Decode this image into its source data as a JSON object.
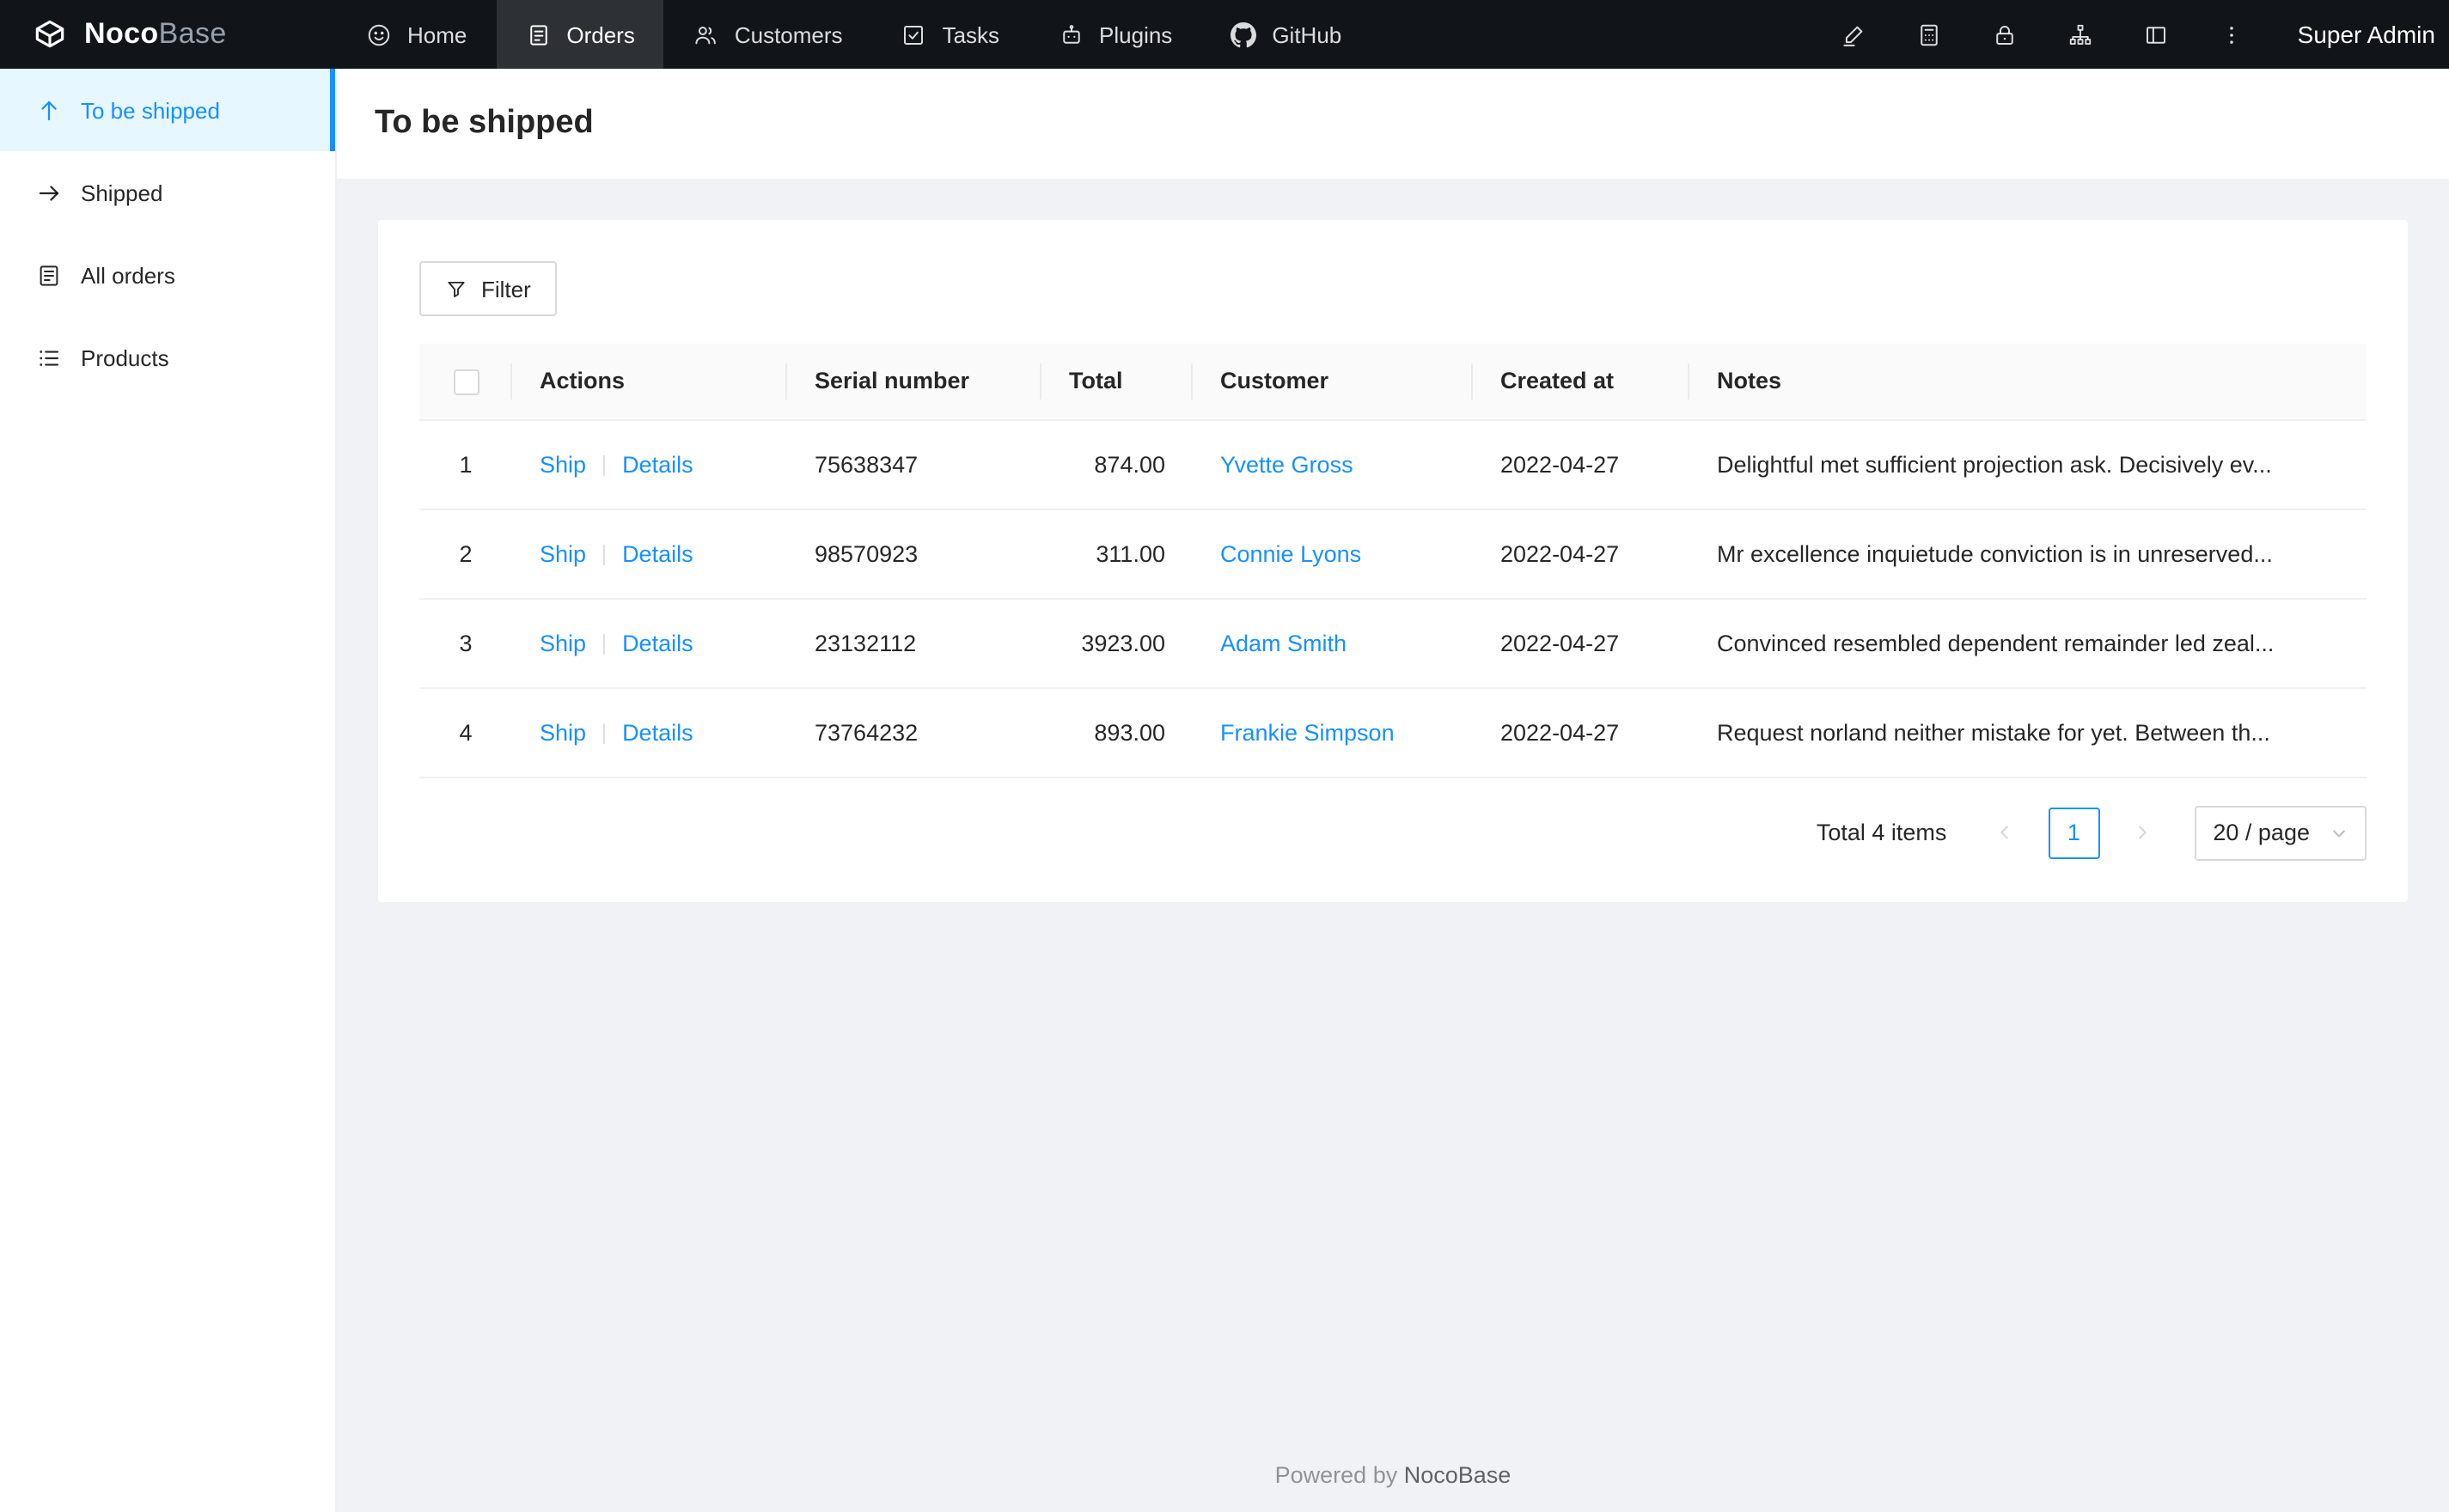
{
  "colors": {
    "accent": "#1890ff",
    "header_bg": "#11151a",
    "sidebar_active_bg": "#e6f7ff",
    "content_bg": "#f0f2f5"
  },
  "header": {
    "brand": {
      "part1": "Noco",
      "part2": "Base"
    },
    "nav": [
      {
        "label": "Home"
      },
      {
        "label": "Orders"
      },
      {
        "label": "Customers"
      },
      {
        "label": "Tasks"
      },
      {
        "label": "Plugins"
      },
      {
        "label": "GitHub"
      }
    ],
    "user": "Super Admin"
  },
  "sidebar": {
    "items": [
      {
        "label": "To be shipped"
      },
      {
        "label": "Shipped"
      },
      {
        "label": "All orders"
      },
      {
        "label": "Products"
      }
    ]
  },
  "page": {
    "title": "To be shipped"
  },
  "toolbar": {
    "filter_label": "Filter"
  },
  "table": {
    "columns": {
      "actions": "Actions",
      "serial": "Serial number",
      "total": "Total",
      "customer": "Customer",
      "created": "Created at",
      "notes": "Notes"
    },
    "rows": [
      {
        "index": "1",
        "ship": "Ship",
        "details": "Details",
        "serial": "75638347",
        "total": "874.00",
        "customer": "Yvette Gross",
        "created": "2022-04-27",
        "notes": "Delightful met sufficient projection ask. Decisively ev..."
      },
      {
        "index": "2",
        "ship": "Ship",
        "details": "Details",
        "serial": "98570923",
        "total": "311.00",
        "customer": "Connie Lyons",
        "created": "2022-04-27",
        "notes": "Mr excellence inquietude conviction is in unreserved..."
      },
      {
        "index": "3",
        "ship": "Ship",
        "details": "Details",
        "serial": "23132112",
        "total": "3923.00",
        "customer": "Adam Smith",
        "created": "2022-04-27",
        "notes": "Convinced resembled dependent remainder led zeal..."
      },
      {
        "index": "4",
        "ship": "Ship",
        "details": "Details",
        "serial": "73764232",
        "total": "893.00",
        "customer": "Frankie Simpson",
        "created": "2022-04-27",
        "notes": "Request norland neither mistake for yet. Between th..."
      }
    ]
  },
  "pagination": {
    "total_text": "Total 4 items",
    "current_page": "1",
    "page_size": "20 / page"
  },
  "footer": {
    "powered_by": "Powered by",
    "brand": "NocoBase"
  }
}
